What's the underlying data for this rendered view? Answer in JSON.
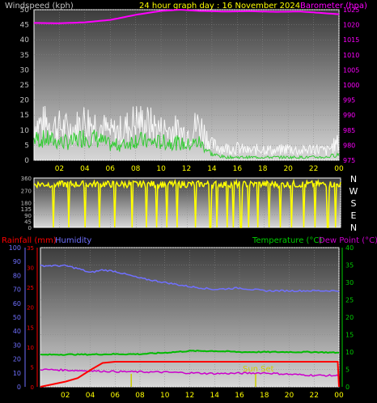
{
  "header": {
    "wind_label": "Windspeed (kph)",
    "title": "24 hour graph day : 16 November 2024",
    "baro_label": "Barometer (hpa)"
  },
  "lower_header": {
    "rain_label": "Rainfall (mm)",
    "humidity_label": "Humidity",
    "temp_label": "Temperature (°C)",
    "dew_label": "Dew Point (°C)"
  },
  "compass": [
    "N",
    "W",
    "S",
    "E",
    "N"
  ],
  "sunset_label": "Sun Set",
  "colors": {
    "wind": "#ffffff",
    "gust": "#ffffff",
    "wind_avg": "#33cc33",
    "baro": "#ff00ff",
    "direction": "#ffff00",
    "rain": "#ff0000",
    "humidity": "#7070ff",
    "temp": "#00cc00",
    "dew": "#cc00cc",
    "sunset": "#cccc00"
  },
  "chart_data": [
    {
      "type": "line",
      "name": "wind-baro",
      "x_ticks": [
        "02",
        "04",
        "06",
        "08",
        "10",
        "12",
        "14",
        "16",
        "18",
        "20",
        "22",
        "00"
      ],
      "y_left": {
        "ticks": [
          0,
          5,
          10,
          15,
          20,
          25,
          30,
          35,
          40,
          45,
          50
        ],
        "ylim": [
          0,
          50
        ]
      },
      "y_right": {
        "ticks": [
          975,
          980,
          985,
          990,
          995,
          1000,
          1005,
          1010,
          1015,
          1020,
          1025
        ],
        "ylim": [
          975,
          1025
        ]
      },
      "wind_profile": {
        "hours": [
          0,
          1,
          2,
          3,
          4,
          5,
          6,
          7,
          8,
          9,
          10,
          11,
          12,
          13,
          14,
          15,
          16,
          17,
          18,
          19,
          20,
          21,
          22,
          23,
          24
        ],
        "gust": [
          12,
          12,
          11,
          10,
          13,
          12,
          9,
          10,
          13,
          12,
          10,
          10,
          9,
          12,
          5,
          4,
          4,
          3,
          4,
          3,
          4,
          3,
          4,
          3,
          6
        ],
        "avg": [
          7,
          7,
          6,
          6,
          8,
          7,
          5,
          5,
          7,
          6,
          6,
          6,
          5,
          6,
          2,
          1,
          1,
          1,
          1,
          1,
          1,
          1,
          1,
          1,
          2
        ]
      },
      "baro": {
        "hours": [
          0,
          2,
          4,
          6,
          8,
          10,
          11.5,
          13,
          15,
          17,
          19,
          21,
          23,
          24
        ],
        "values": [
          1020.6,
          1020.5,
          1020.8,
          1021.6,
          1023.3,
          1024.6,
          1025.0,
          1024.6,
          1024.4,
          1024.5,
          1024.3,
          1024.4,
          1023.8,
          1023.5
        ]
      }
    },
    {
      "type": "line",
      "name": "wind-direction",
      "y_ticks": [
        0,
        45,
        90,
        135,
        180,
        270,
        360
      ],
      "ylim": [
        0,
        360
      ],
      "typical": 315,
      "drops_hours": [
        1.5,
        2.7,
        4.0,
        5.1,
        6.3,
        7.7,
        8.8,
        9.6,
        10.4,
        11.2,
        12.6,
        13.8,
        14.3,
        15.1,
        15.6,
        16.2,
        16.8,
        17.5,
        18.4,
        19.3,
        20.2,
        21.1,
        22.0,
        23.0,
        23.6
      ]
    },
    {
      "type": "line",
      "name": "rain-humidity-temp",
      "x_ticks": [
        "02",
        "04",
        "06",
        "08",
        "10",
        "12",
        "14",
        "16",
        "18",
        "20",
        "22",
        "00"
      ],
      "humidity_ticks": [
        0,
        10,
        20,
        30,
        40,
        50,
        60,
        70,
        80,
        90,
        100
      ],
      "rain_ticks": [
        0,
        5,
        10,
        15,
        20,
        25,
        30,
        35
      ],
      "temp_ticks": [
        0,
        5,
        10,
        15,
        20,
        25,
        30,
        35,
        40
      ],
      "humidity": {
        "hours": [
          0,
          2,
          3,
          4,
          5,
          6,
          8,
          10,
          12,
          14,
          16,
          18,
          20,
          22,
          24
        ],
        "values": [
          87,
          87,
          85,
          82,
          84,
          83,
          78,
          75,
          72,
          70,
          71,
          69,
          69,
          69,
          69
        ]
      },
      "rain": {
        "hours": [
          0,
          2,
          3,
          4,
          5,
          6,
          8,
          12,
          16,
          20,
          23.9,
          24
        ],
        "values": [
          0,
          1.3,
          2.2,
          4.2,
          6.0,
          6.3,
          6.3,
          6.3,
          6.3,
          6.3,
          6.3,
          0
        ]
      },
      "temperature": {
        "hours": [
          0,
          2,
          4,
          6,
          8,
          10,
          12,
          14,
          16,
          18,
          20,
          22,
          24
        ],
        "values": [
          9.2,
          9.3,
          9.3,
          9.4,
          9.4,
          9.8,
          10.3,
          10.3,
          10.0,
          10.0,
          10.0,
          10.0,
          9.8
        ]
      },
      "dew_point": {
        "hours": [
          0,
          2,
          4,
          6,
          8,
          10,
          12,
          14,
          16,
          18,
          20,
          22,
          24
        ],
        "values": [
          5.0,
          4.8,
          4.6,
          4.4,
          4.3,
          4.2,
          4.0,
          3.8,
          3.9,
          4.0,
          3.6,
          3.3,
          3.2
        ]
      },
      "sunset_hour": 17.3,
      "sunrise_hour": 7.3
    }
  ]
}
